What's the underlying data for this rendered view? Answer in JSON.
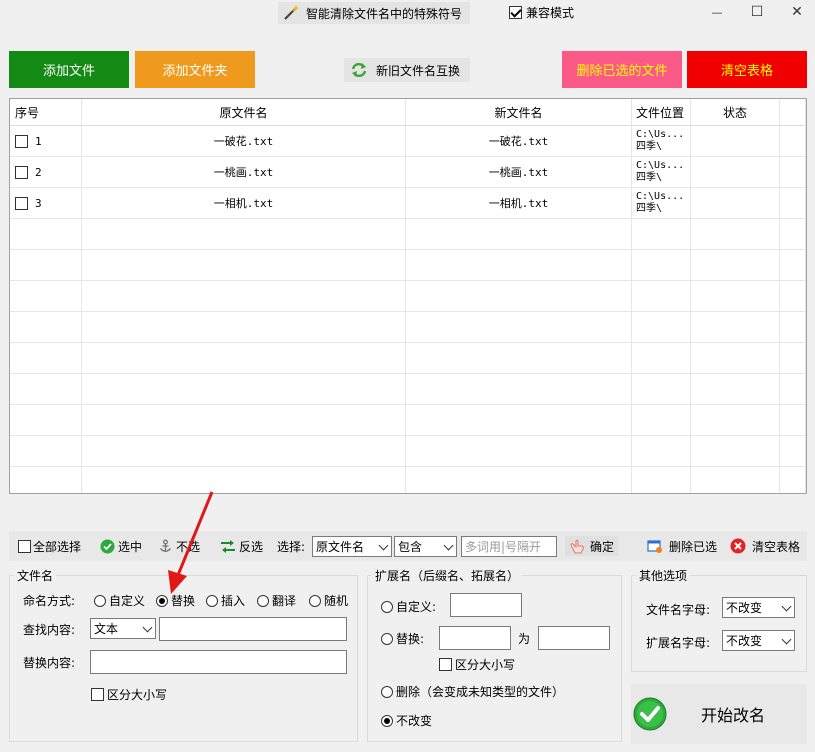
{
  "window": {
    "title": "智能清除文件名中的特殊符号",
    "compat_mode_label": "兼容模式",
    "compat_mode_checked": true,
    "minimize_glyph": "—",
    "maximize_glyph": "☐",
    "close_glyph": "✕"
  },
  "top_buttons": {
    "add_file": "添加文件",
    "add_folder": "添加文件夹",
    "swap_names": "新旧文件名互换",
    "delete_selected": "删除已选的文件",
    "clear_table": "清空表格",
    "colors": {
      "add_file_bg": "#138a13",
      "add_folder_bg": "#ef9a1d",
      "delete_selected_bg": "#fb5a88",
      "delete_selected_text": "#ffff00",
      "clear_table_bg": "#f00000",
      "clear_table_text": "#ffff00"
    }
  },
  "table": {
    "headers": {
      "index": "序号",
      "old_name": "原文件名",
      "new_name": "新文件名",
      "location": "文件位置",
      "status": "状态"
    },
    "rows": [
      {
        "index": "1",
        "old_name": "一破花.txt",
        "new_name": "一破花.txt",
        "location": "C:\\Us...\n四季\\",
        "status": ""
      },
      {
        "index": "2",
        "old_name": "一桃画.txt",
        "new_name": "一桃画.txt",
        "location": "C:\\Us...\n四季\\",
        "status": ""
      },
      {
        "index": "3",
        "old_name": "一相机.txt",
        "new_name": "一相机.txt",
        "location": "C:\\Us...\n四季\\",
        "status": ""
      }
    ]
  },
  "toolbar": {
    "select_all": "全部选择",
    "select": "选中",
    "deselect": "不选",
    "invert": "反选",
    "choose_label": "选择:",
    "field_value": "原文件名",
    "match_value": "包含",
    "keyword_placeholder": "多词用|号隔开",
    "confirm": "确定",
    "delete_selected": "删除已选",
    "clear_table": "清空表格"
  },
  "filename_group": {
    "title": "文件名",
    "mode_label": "命名方式:",
    "modes": [
      "自定义",
      "替换",
      "插入",
      "翻译",
      "随机"
    ],
    "selected_mode": "替换",
    "find_label": "查找内容:",
    "find_type": "文本",
    "find_value": "",
    "replace_label": "替换内容:",
    "replace_value": "",
    "case_sensitive": "区分大小写"
  },
  "extension_group": {
    "title": "扩展名（后缀名、拓展名）",
    "custom": "自定义:",
    "replace": "替换:",
    "to": "为",
    "case_sensitive": "区分大小写",
    "delete": "删除（会变成未知类型的文件）",
    "unchanged": "不改变"
  },
  "other_group": {
    "title": "其他选项",
    "filename_case_label": "文件名字母:",
    "filename_case_value": "不改变",
    "ext_case_label": "扩展名字母:",
    "ext_case_value": "不改变"
  },
  "start_button": "开始改名"
}
